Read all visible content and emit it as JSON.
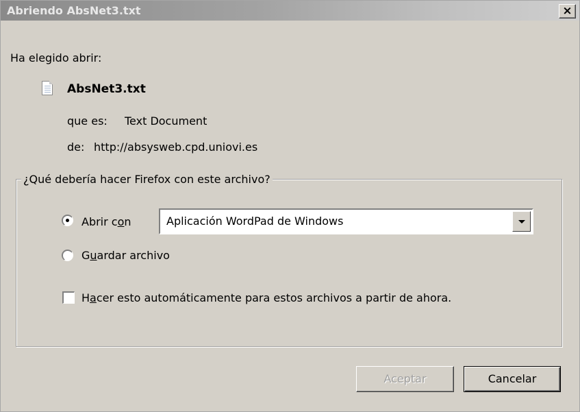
{
  "window": {
    "title": "Abriendo AbsNet3.txt",
    "close_label": "×"
  },
  "intro": {
    "label": "Ha elegido abrir:"
  },
  "file": {
    "icon": "text-file-icon",
    "name": "AbsNet3.txt",
    "type_label": "que es:",
    "type_value": "Text Document",
    "from_label": "de:",
    "from_value": "http://absysweb.cpd.uniovi.es"
  },
  "action_group": {
    "legend": "¿Qué debería hacer Firefox con este archivo?",
    "open_with": {
      "label_pre": "Abrir c",
      "label_accel": "o",
      "label_post": "n",
      "selected": true,
      "app_value": "Aplicación WordPad de Windows"
    },
    "save_file": {
      "label_pre": "G",
      "label_accel": "u",
      "label_post": "ardar archivo",
      "selected": false
    },
    "auto_checkbox": {
      "label_pre": "H",
      "label_accel": "a",
      "label_post": "cer esto automáticamente para estos archivos a partir de ahora.",
      "checked": false
    }
  },
  "buttons": {
    "ok_label": "Aceptar",
    "ok_enabled": false,
    "cancel_label": "Cancelar"
  },
  "colors": {
    "dialog_bg": "#d4d0c8",
    "title_text": "#e8e8e8",
    "disabled_text": "#a0a0a0"
  }
}
